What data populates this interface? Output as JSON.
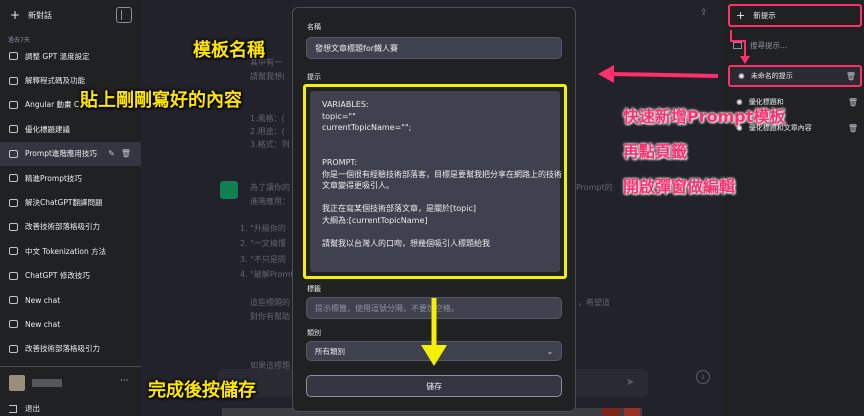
{
  "sidebar": {
    "new_chat": "新對話",
    "section": "過去7天",
    "items": [
      {
        "label": "調整 GPT 溫度設定"
      },
      {
        "label": "解釋程式碼及功能"
      },
      {
        "label": "Angular 動畫 C"
      },
      {
        "label": "優化標題建議"
      },
      {
        "label": "Prompt進階應用技巧"
      },
      {
        "label": "精進Prompt技巧"
      },
      {
        "label": "解決ChatGPT翻譯問題"
      },
      {
        "label": "改善技術部落格吸引力"
      },
      {
        "label": "中文 Tokenization 方法"
      },
      {
        "label": "ChatGPT 修改技巧"
      },
      {
        "label": "New chat"
      },
      {
        "label": "New chat"
      },
      {
        "label": "改善技術部落格吸引力"
      }
    ],
    "active_index": 4,
    "more": "···",
    "logout": "退出"
  },
  "main": {
    "share_icon": "share-icon",
    "lines_top": [
      "其中有一",
      "請幫我想(",
      "",
      "1.風格：(",
      "2.用途：(",
      "3.格式：列"
    ],
    "para1": [
      "為了讓你的",
      "進階應用："
    ],
    "para1_right": "Prompt的",
    "list": [
      "1. \"升級你的",
      "2. \"一文搞懂",
      "3. \"不只是問",
      "4. \"破解Promt"
    ],
    "para2": [
      "這些標題的",
      "對你有幫助"
    ],
    "para2_right": "，希望這",
    "bottom_hint": "如果這標題"
  },
  "prompt_panel": {
    "new_prompt": "新提示",
    "search_placeholder": "搜尋提示...",
    "items": [
      {
        "label": "未命名的提示"
      },
      {
        "label": "優化標題和"
      },
      {
        "label": "優化標題和文章內容"
      }
    ]
  },
  "modal": {
    "name_label": "名稱",
    "name_value": "發想文章標題for鐵人賽",
    "prompt_label": "提示",
    "prompt_value": "VARIABLES:\ntopic=\"\"\ncurrentTopicName=\"\";\n\n\nPROMPT:\n你是一個很有經驗技術部落客，目標是要幫我把分享在網路上的技術文章變得更吸引人。\n\n我正在寫某個技術部落文章，是關於[topic]\n大綱為:[currentTopicName]\n\n請幫我以台灣人的口吻，想幾個吸引人標題給我",
    "tags_label": "標籤",
    "tags_placeholder": "提示標籤，使用逗號分隔，不要加空格。",
    "category_label": "類別",
    "category_value": "所有類別",
    "save_label": "儲存"
  },
  "annotations": {
    "template_name": "模板名稱",
    "paste_content": "貼上剛剛寫好的內容",
    "quick_add": "快速新增Prompt模板",
    "click_again": "再點頁籤",
    "open_modal": "開啟彈窗做編輯",
    "save_after": "完成後按儲存"
  },
  "colors": {
    "highlight_yellow": "#f4f000",
    "highlight_pink": "#ff2f6e",
    "sidebar_bg": "#202123",
    "main_bg": "#343541"
  }
}
